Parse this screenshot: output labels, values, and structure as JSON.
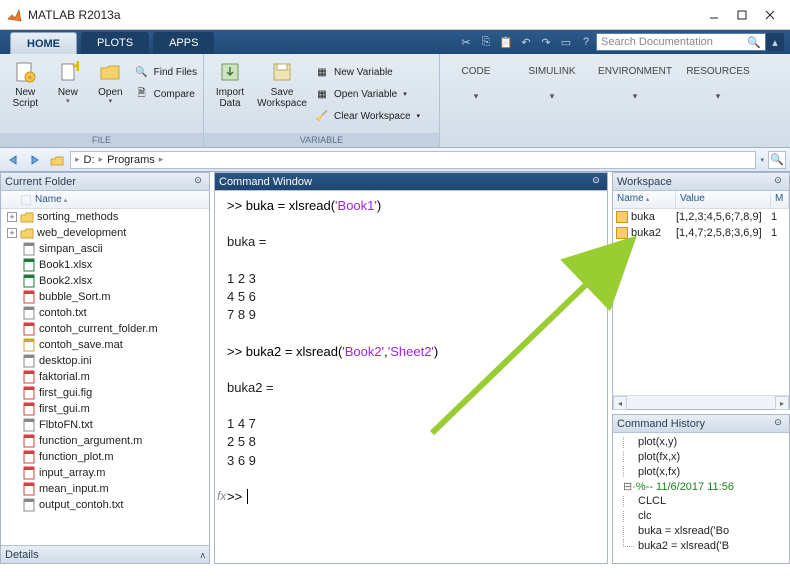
{
  "app_title": "MATLAB R2013a",
  "tabs": {
    "home": "HOME",
    "plots": "PLOTS",
    "apps": "APPS"
  },
  "search_placeholder": "Search Documentation",
  "ribbon": {
    "file": {
      "new_script": "New\nScript",
      "new": "New",
      "open": "Open",
      "find_files": "Find Files",
      "compare": "Compare",
      "label": "FILE"
    },
    "variable": {
      "import": "Import\nData",
      "save_ws": "Save\nWorkspace",
      "new_var": "New Variable",
      "open_var": "Open Variable",
      "clear_ws": "Clear Workspace",
      "label": "VARIABLE"
    },
    "collapsed": [
      "CODE",
      "SIMULINK",
      "ENVIRONMENT",
      "RESOURCES"
    ]
  },
  "address": {
    "drive": "D:",
    "folder": "Programs"
  },
  "current_folder": {
    "title": "Current Folder",
    "col": "Name",
    "details": "Details",
    "items": [
      {
        "t": "folder",
        "name": "sorting_methods",
        "exp": "+"
      },
      {
        "t": "folder",
        "name": "web_development",
        "exp": "+"
      },
      {
        "t": "file",
        "name": "simpan_ascii",
        "ic": "txt"
      },
      {
        "t": "file",
        "name": "Book1.xlsx",
        "ic": "xls"
      },
      {
        "t": "file",
        "name": "Book2.xlsx",
        "ic": "xls"
      },
      {
        "t": "file",
        "name": "bubble_Sort.m",
        "ic": "m"
      },
      {
        "t": "file",
        "name": "contoh.txt",
        "ic": "txt"
      },
      {
        "t": "file",
        "name": "contoh_current_folder.m",
        "ic": "m"
      },
      {
        "t": "file",
        "name": "contoh_save.mat",
        "ic": "mat"
      },
      {
        "t": "file",
        "name": "desktop.ini",
        "ic": "txt"
      },
      {
        "t": "file",
        "name": "faktorial.m",
        "ic": "m"
      },
      {
        "t": "file",
        "name": "first_gui.fig",
        "ic": "fig"
      },
      {
        "t": "file",
        "name": "first_gui.m",
        "ic": "m"
      },
      {
        "t": "file",
        "name": "FlbtoFN.txt",
        "ic": "txt"
      },
      {
        "t": "file",
        "name": "function_argument.m",
        "ic": "m"
      },
      {
        "t": "file",
        "name": "function_plot.m",
        "ic": "m"
      },
      {
        "t": "file",
        "name": "input_array.m",
        "ic": "m"
      },
      {
        "t": "file",
        "name": "mean_input.m",
        "ic": "m"
      },
      {
        "t": "file",
        "name": "output_contoh.txt",
        "ic": "txt"
      }
    ]
  },
  "command_window": {
    "title": "Command Window",
    "lines": [
      {
        "type": "cmd",
        "prompt": ">> ",
        "plain": "buka = xlsread(",
        "str": "'Book1'",
        "tail": ")"
      },
      {
        "type": "blank"
      },
      {
        "type": "out",
        "text": "buka ="
      },
      {
        "type": "blank"
      },
      {
        "type": "out",
        "text": "     1     2     3"
      },
      {
        "type": "out",
        "text": "     4     5     6"
      },
      {
        "type": "out",
        "text": "     7     8     9"
      },
      {
        "type": "blank"
      },
      {
        "type": "cmd",
        "prompt": ">> ",
        "plain": "buka2 = xlsread(",
        "str": "'Book2'",
        "mid": ",",
        "str2": "'Sheet2'",
        "tail": ")"
      },
      {
        "type": "blank"
      },
      {
        "type": "out",
        "text": "buka2 ="
      },
      {
        "type": "blank"
      },
      {
        "type": "out",
        "text": "     1     4     7"
      },
      {
        "type": "out",
        "text": "     2     5     8"
      },
      {
        "type": "out",
        "text": "     3     6     9"
      },
      {
        "type": "blank"
      },
      {
        "type": "cmd",
        "prompt": ">> ",
        "plain": "",
        "fx": true
      }
    ],
    "fx": "fx"
  },
  "workspace": {
    "title": "Workspace",
    "cols": [
      "Name",
      "Value",
      "M"
    ],
    "rows": [
      {
        "name": "buka",
        "value": "[1,2,3;4,5,6;7,8,9]",
        "min": "1"
      },
      {
        "name": "buka2",
        "value": "[1,4,7;2,5,8;3,6,9]",
        "min": "1"
      }
    ]
  },
  "command_history": {
    "title": "Command History",
    "lines": [
      "plot(x,y)",
      "plot(fx,x)",
      "plot(x,fx)",
      "%-- 11/6/2017 11:56",
      "CLCL",
      "clc",
      "buka = xlsread('Bo",
      "buka2 = xlsread('B"
    ]
  }
}
